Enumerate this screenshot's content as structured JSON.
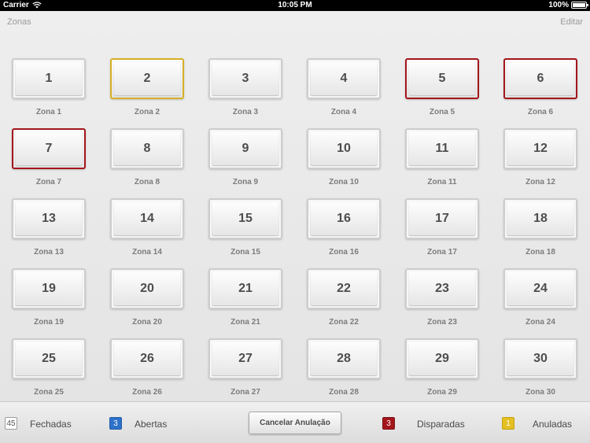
{
  "status_bar": {
    "carrier": "Carrier",
    "time": "10:05 PM",
    "battery": "100%",
    "icons": [
      "wifi-icon",
      "battery-icon"
    ]
  },
  "header": {
    "left_tab": "Zonas",
    "right_tab": "Editar"
  },
  "zones": [
    {
      "number": "1",
      "label": "Zona 1",
      "state": "normal"
    },
    {
      "number": "2",
      "label": "Zona 2",
      "state": "annulled"
    },
    {
      "number": "3",
      "label": "Zona 3",
      "state": "normal"
    },
    {
      "number": "4",
      "label": "Zona 4",
      "state": "normal"
    },
    {
      "number": "5",
      "label": "Zona 5",
      "state": "triggered"
    },
    {
      "number": "6",
      "label": "Zona 6",
      "state": "triggered"
    },
    {
      "number": "7",
      "label": "Zona 7",
      "state": "triggered"
    },
    {
      "number": "8",
      "label": "Zona 8",
      "state": "normal"
    },
    {
      "number": "9",
      "label": "Zona 9",
      "state": "normal"
    },
    {
      "number": "10",
      "label": "Zona 10",
      "state": "normal"
    },
    {
      "number": "11",
      "label": "Zona 11",
      "state": "normal"
    },
    {
      "number": "12",
      "label": "Zona 12",
      "state": "normal"
    },
    {
      "number": "13",
      "label": "Zona 13",
      "state": "normal"
    },
    {
      "number": "14",
      "label": "Zona 14",
      "state": "normal"
    },
    {
      "number": "15",
      "label": "Zona 15",
      "state": "normal"
    },
    {
      "number": "16",
      "label": "Zona 16",
      "state": "normal"
    },
    {
      "number": "17",
      "label": "Zona 17",
      "state": "normal"
    },
    {
      "number": "18",
      "label": "Zona 18",
      "state": "normal"
    },
    {
      "number": "19",
      "label": "Zona 19",
      "state": "normal"
    },
    {
      "number": "20",
      "label": "Zona 20",
      "state": "normal"
    },
    {
      "number": "21",
      "label": "Zona 21",
      "state": "normal"
    },
    {
      "number": "22",
      "label": "Zona 22",
      "state": "normal"
    },
    {
      "number": "23",
      "label": "Zona 23",
      "state": "normal"
    },
    {
      "number": "24",
      "label": "Zona 24",
      "state": "normal"
    },
    {
      "number": "25",
      "label": "Zona 25",
      "state": "normal"
    },
    {
      "number": "26",
      "label": "Zona 26",
      "state": "normal"
    },
    {
      "number": "27",
      "label": "Zona 27",
      "state": "normal"
    },
    {
      "number": "28",
      "label": "Zona 28",
      "state": "normal"
    },
    {
      "number": "29",
      "label": "Zona 29",
      "state": "normal"
    },
    {
      "number": "30",
      "label": "Zona 30",
      "state": "normal"
    }
  ],
  "legend": {
    "closed": {
      "count": "45",
      "label": "Fechadas"
    },
    "open": {
      "count": "3",
      "label": "Abertas",
      "color": "#2e72c9"
    },
    "triggered": {
      "count": "3",
      "label": "Disparadas",
      "color": "#a3161c"
    },
    "annulled": {
      "count": "1",
      "label": "Anuladas",
      "color": "#e5c022"
    }
  },
  "cancel_button": "Cancelar Anulação"
}
